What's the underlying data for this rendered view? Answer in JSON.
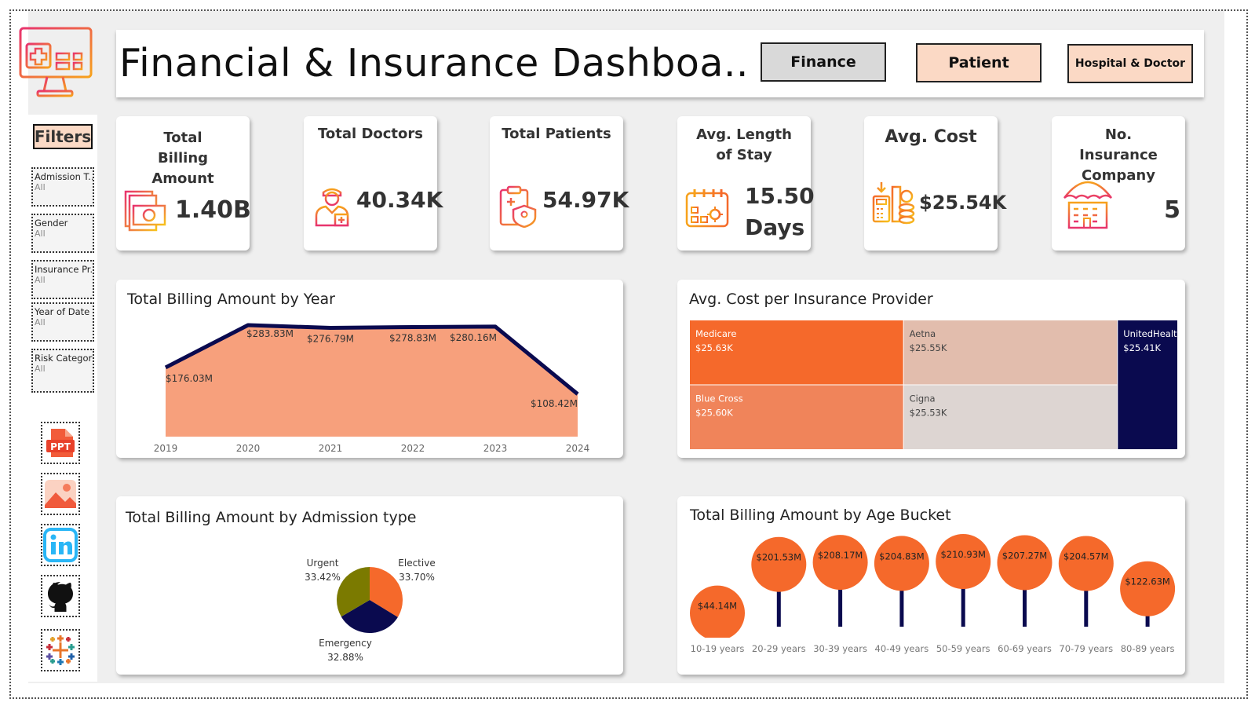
{
  "header": {
    "title": "Financial & Insurance Dashboa..",
    "nav": [
      {
        "label": "Finance",
        "bg": "#d9d9d9"
      },
      {
        "label": "Patient",
        "bg": "#fbd9c5"
      },
      {
        "label": "Hospital & Doctor",
        "bg": "#fbd9c5"
      }
    ]
  },
  "filters": {
    "title": "Filters",
    "items": [
      {
        "label": "Admission T..",
        "value": "All"
      },
      {
        "label": "Gender",
        "value": "All"
      },
      {
        "label": "Insurance Pr..",
        "value": "All"
      },
      {
        "label": "Year of Date ..",
        "value": "All"
      },
      {
        "label": "Risk Category",
        "value": "All"
      }
    ]
  },
  "side_links": [
    "ppt-icon",
    "image-icon",
    "linkedin-icon",
    "github-icon",
    "tableau-icon"
  ],
  "kpis": [
    {
      "title": "Total Billing Amount",
      "value": "1.40B",
      "icon": "cash-icon"
    },
    {
      "title": "Total Doctors",
      "value": "40.34K",
      "icon": "doctor-icon"
    },
    {
      "title": "Total Patients",
      "value": "54.97K",
      "icon": "patient-clipboard-icon"
    },
    {
      "title": "Avg. Length of Stay",
      "value": "15.50 Days",
      "icon": "calendar-icon"
    },
    {
      "title": "Avg. Cost",
      "value": "$25.54K",
      "icon": "coins-calculator-icon"
    },
    {
      "title": "No. Insurance Company",
      "value": "5",
      "icon": "umbrella-building-icon"
    }
  ],
  "colors": {
    "orange": "#f5692b",
    "navy": "#0a0a4f",
    "area": "#f7a07c",
    "olive": "#7b7a00"
  },
  "chart_data": [
    {
      "type": "area",
      "title": "Total Billing Amount by Year",
      "x": [
        "2019",
        "2020",
        "2021",
        "2022",
        "2023",
        "2024"
      ],
      "values": [
        176.03,
        283.83,
        276.79,
        278.83,
        280.16,
        108.42
      ],
      "labels": [
        "$176.03M",
        "$283.83M",
        "$276.79M",
        "$278.83M",
        "$280.16M",
        "$108.42M"
      ],
      "unit": "M",
      "grid": false
    },
    {
      "type": "treemap",
      "title": "Avg. Cost per Insurance Provider",
      "items": [
        {
          "name": "Medicare",
          "label": "$25.63K",
          "value": 25.63,
          "color": "#f5692b"
        },
        {
          "name": "Blue Cross",
          "label": "$25.60K",
          "value": 25.6,
          "color": "#f0845a"
        },
        {
          "name": "Aetna",
          "label": "$25.55K",
          "value": 25.55,
          "color": "#e2bdad"
        },
        {
          "name": "Cigna",
          "label": "$25.53K",
          "value": 25.53,
          "color": "#ddd5d2"
        },
        {
          "name": "UnitedHealthcare",
          "label": "$25.41K",
          "value": 25.41,
          "color": "#0a0a4f"
        }
      ]
    },
    {
      "type": "pie",
      "title": "Total Billing Amount by Admission type",
      "slices": [
        {
          "name": "Elective",
          "label": "33.70%",
          "value": 33.7,
          "color": "#f5692b"
        },
        {
          "name": "Emergency",
          "label": "32.88%",
          "value": 32.88,
          "color": "#0a0a4f"
        },
        {
          "name": "Urgent",
          "label": "33.42%",
          "value": 33.42,
          "color": "#7b7a00"
        }
      ]
    },
    {
      "type": "lollipop",
      "title": "Total Billing Amount by Age Bucket",
      "categories": [
        "10-19 years",
        "20-29 years",
        "30-39 years",
        "40-49 years",
        "50-59 years",
        "60-69 years",
        "70-79 years",
        "80-89 years"
      ],
      "values": [
        44.14,
        201.53,
        208.17,
        204.83,
        210.93,
        207.27,
        204.57,
        122.63
      ],
      "labels": [
        "$44.14M",
        "$201.53M",
        "$208.17M",
        "$204.83M",
        "$210.93M",
        "$207.27M",
        "$204.57M",
        "$122.63M"
      ]
    }
  ]
}
